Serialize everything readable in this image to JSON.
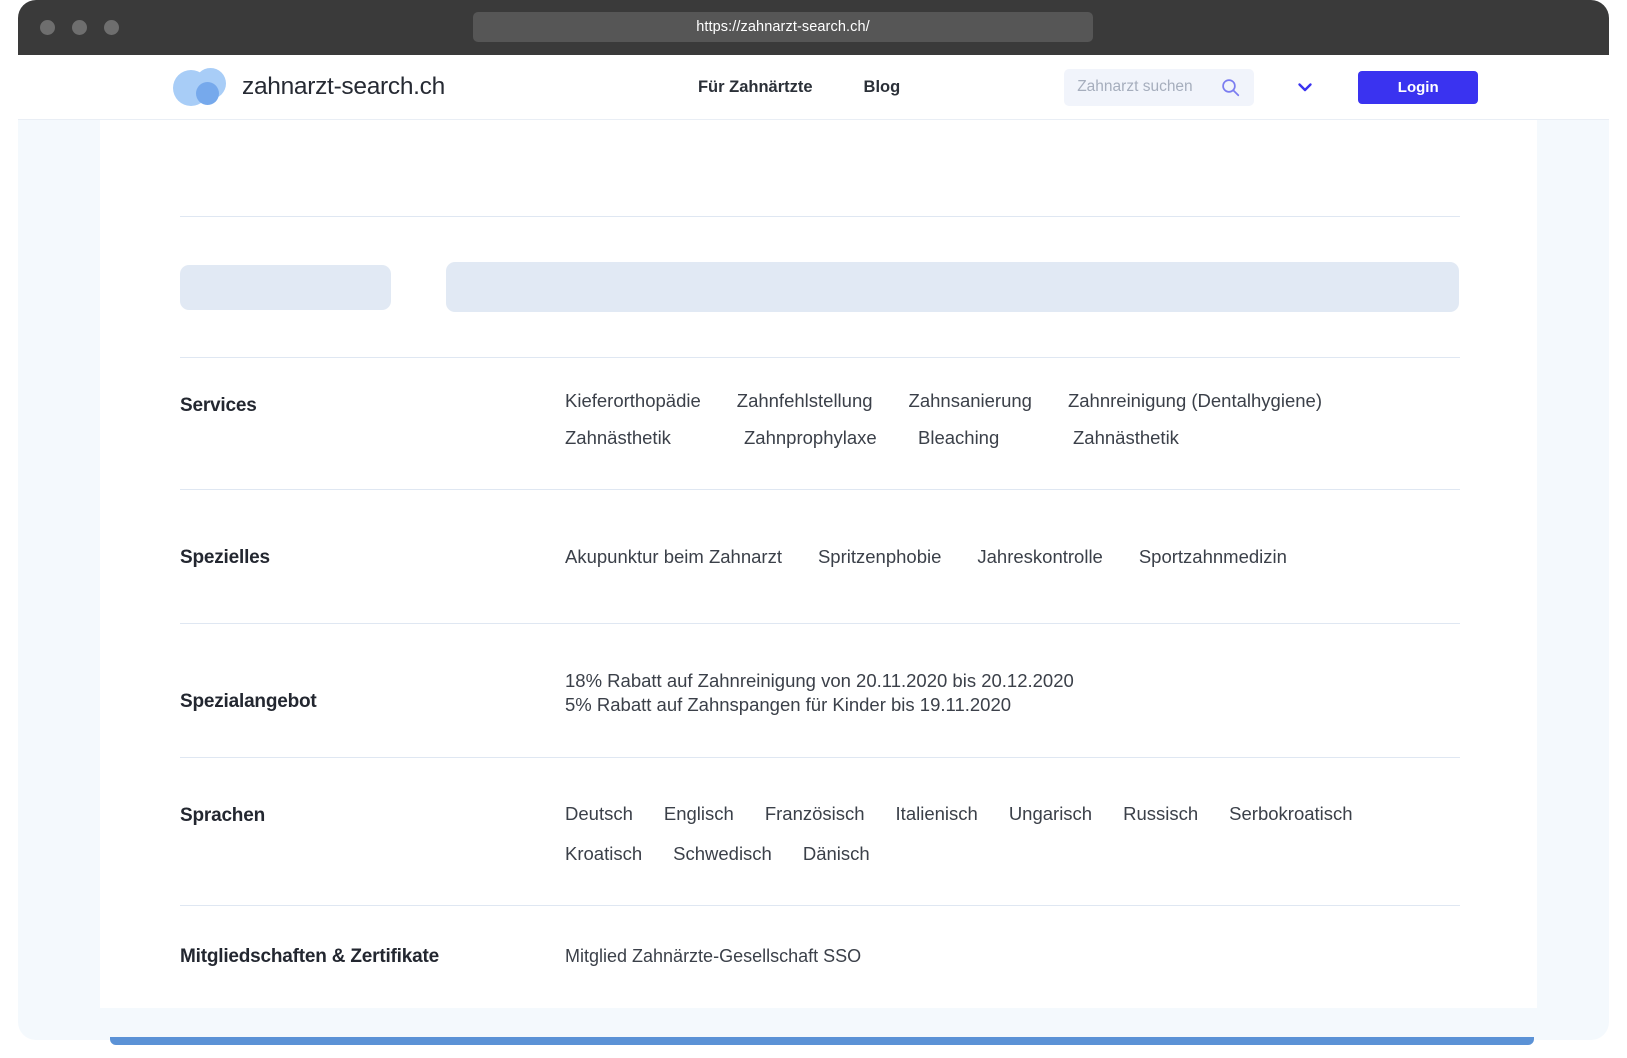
{
  "browser": {
    "url": "https://zahnarzt-search.ch/",
    "traffic_lights": [
      "close-dot",
      "minimize-dot",
      "maximize-dot"
    ]
  },
  "header": {
    "brand_name": "zahnarzt-search.ch",
    "logo_icon": "overlapping-circles-logo",
    "nav": [
      {
        "label": "Für Zahnärtzte",
        "name": "nav-link-fuer-zahnaerztze"
      },
      {
        "label": "Blog",
        "name": "nav-link-blog"
      }
    ],
    "search": {
      "placeholder": "Zahnarzt suchen",
      "value": "",
      "icon": "search-icon"
    },
    "language_chevron_icon": "chevron-down-icon",
    "login_label": "Login",
    "accent_color": "#3a33f0"
  },
  "skeleton": {
    "small_block": "loading-placeholder-small",
    "large_block": "loading-placeholder-large",
    "color": "#e1e9f4"
  },
  "sections": {
    "services": {
      "label": "Services",
      "items": [
        "Kieferorthopädie",
        "Zahnfehlstellung",
        "Zahnsanierung",
        "Zahnreinigung (Dentalhygiene)",
        "Zahnästhetik",
        "Zahnprophylaxe",
        "Bleaching",
        "Zahnästhetik"
      ]
    },
    "spezielles": {
      "label": "Spezielles",
      "items": [
        "Akupunktur beim Zahnarzt",
        "Spritzenphobie",
        "Jahreskontrolle",
        "Sportzahnmedizin"
      ]
    },
    "spezialangebot": {
      "label": "Spezialangebot",
      "lines": [
        "18% Rabatt auf Zahnreinigung von 20.11.2020 bis 20.12.2020",
        "5% Rabatt auf Zahnspangen für Kinder bis 19.11.2020"
      ]
    },
    "sprachen": {
      "label": "Sprachen",
      "items": [
        "Deutsch",
        "Englisch",
        "Französisch",
        "Italienisch",
        "Ungarisch",
        "Russisch",
        "Serbokroatisch",
        "Kroatisch",
        "Schwedisch",
        "Dänisch"
      ]
    },
    "mitgliedschaften": {
      "label": "Mitgliedschaften & Zertifikate",
      "lines": [
        "Mitglied Zahnärzte-Gesellschaft SSO"
      ]
    }
  }
}
